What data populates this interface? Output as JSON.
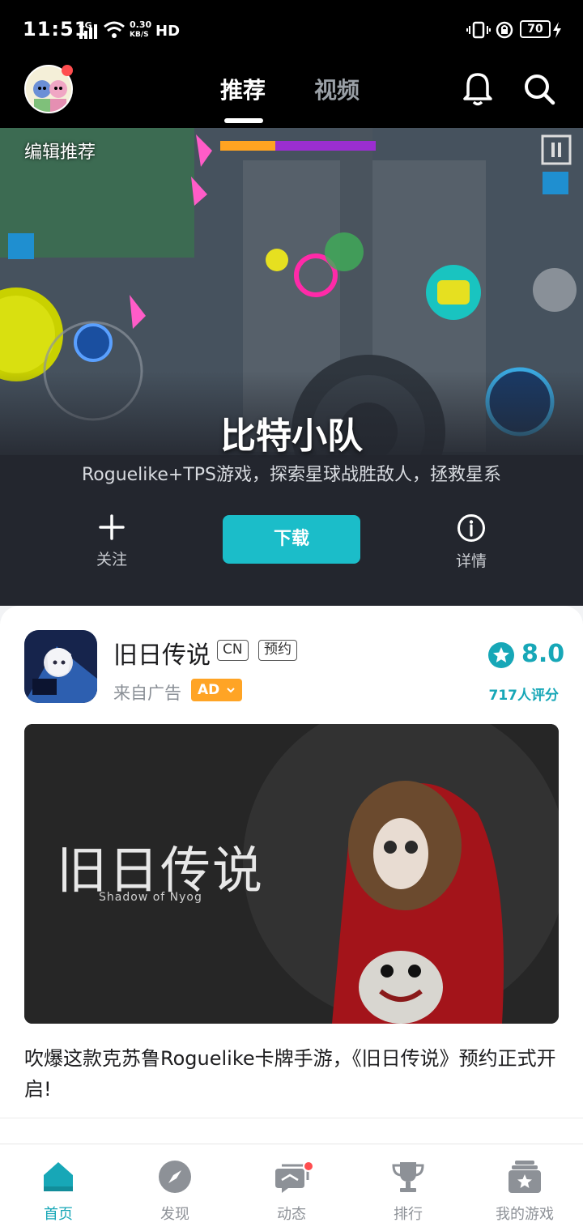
{
  "status_bar": {
    "time": "11:51",
    "network": "4G",
    "speed_value": "0.30",
    "speed_unit": "KB/S",
    "hd": "HD",
    "battery": "70"
  },
  "top_nav": {
    "tabs": [
      {
        "label": "推荐",
        "active": true
      },
      {
        "label": "视频",
        "active": false
      }
    ]
  },
  "banner": {
    "label": "编辑推荐",
    "title": "比特小队",
    "description": "Roguelike+TPS游戏，探索星球战胜敌人，拯救星系",
    "follow_label": "关注",
    "download_label": "下载",
    "details_label": "详情"
  },
  "card": {
    "app_name": "旧日传说",
    "tags": [
      "CN",
      "预约"
    ],
    "ad_from": "来自广告",
    "ad_badge": "AD",
    "rating": "8.0",
    "rating_count": "717人评分",
    "image_title": "旧日传说",
    "image_subtitle": "Shadow of Nyog",
    "description": "吹爆这款克苏鲁Roguelike卡牌手游，《旧日传说》预约正式开启!"
  },
  "bottom_nav": {
    "items": [
      {
        "label": "首页",
        "icon": "home-icon",
        "active": true
      },
      {
        "label": "发现",
        "icon": "compass-icon",
        "active": false
      },
      {
        "label": "动态",
        "icon": "message-icon",
        "active": false
      },
      {
        "label": "排行",
        "icon": "trophy-icon",
        "active": false
      },
      {
        "label": "我的游戏",
        "icon": "game-box-icon",
        "active": false
      }
    ]
  },
  "colors": {
    "accent": "#1bbdc9",
    "rating": "#17a7b7",
    "ad_badge": "#ffa425",
    "notification_dot": "#ff4d4f"
  }
}
